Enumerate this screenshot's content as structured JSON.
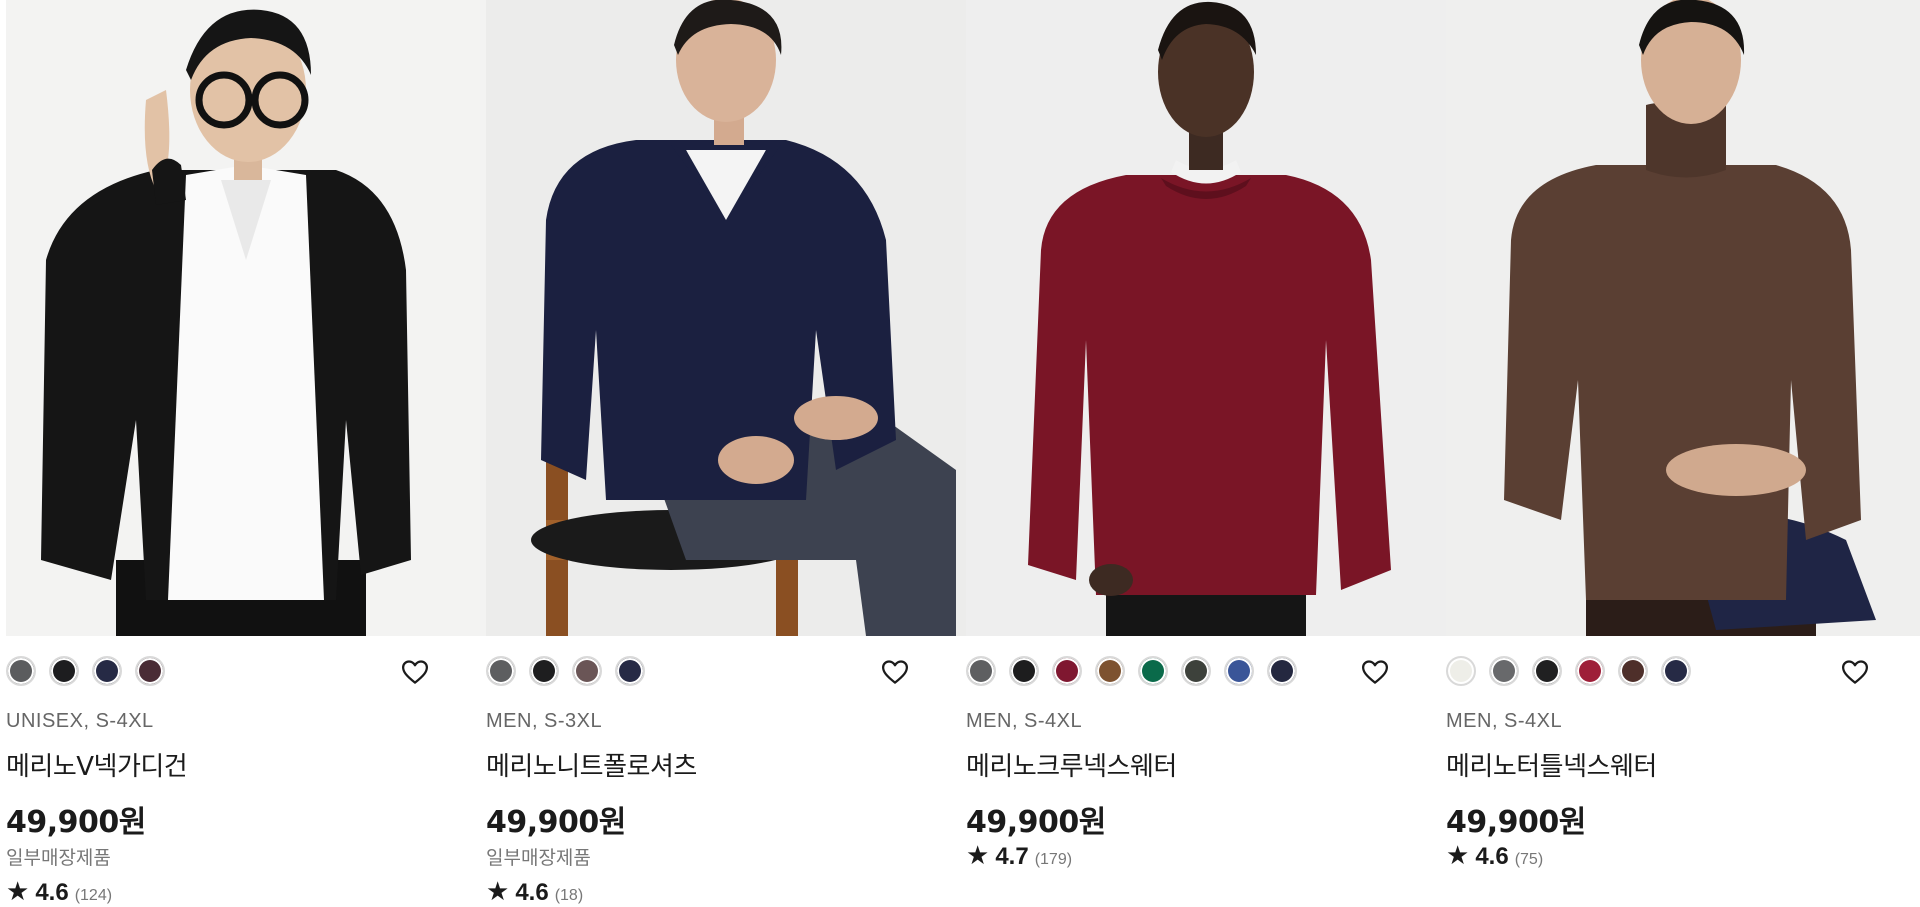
{
  "products": [
    {
      "meta": "UNISEX, S-4XL",
      "name": "메리노V넥가디건",
      "price": "49,900원",
      "note": "일부매장제품",
      "rating": {
        "star": "★",
        "score": "4.6",
        "count": "(124)"
      },
      "swatches": [
        "#5b5c5e",
        "#1d1d1f",
        "#262a45",
        "#4a2c35"
      ],
      "favorite_icon": "heart-outline-icon"
    },
    {
      "meta": "MEN, S-3XL",
      "name": "메리노니트폴로셔츠",
      "price": "49,900원",
      "note": "일부매장제품",
      "rating": {
        "star": "★",
        "score": "4.6",
        "count": "(18)"
      },
      "swatches": [
        "#5d5e60",
        "#1e1e1f",
        "#6a5556",
        "#262a45"
      ],
      "favorite_icon": "heart-outline-icon"
    },
    {
      "meta": "MEN, S-4XL",
      "name": "메리노크루넥스웨터",
      "price": "49,900원",
      "note": "",
      "rating": {
        "star": "★",
        "score": "4.7",
        "count": "(179)"
      },
      "swatches": [
        "#5e5f61",
        "#1d1d1e",
        "#7f1730",
        "#7d5230",
        "#0a6a4a",
        "#3d413b",
        "#3a5598",
        "#242840"
      ],
      "favorite_icon": "heart-outline-icon"
    },
    {
      "meta": "MEN, S-4XL",
      "name": "메리노터틀넥스웨터",
      "price": "49,900원",
      "note": "",
      "rating": {
        "star": "★",
        "score": "4.6",
        "count": "(75)"
      },
      "swatches": [
        "#eeeee8",
        "#68696b",
        "#202021",
        "#9e1e38",
        "#4e2f2a",
        "#262a45"
      ],
      "favorite_icon": "heart-outline-icon"
    }
  ]
}
